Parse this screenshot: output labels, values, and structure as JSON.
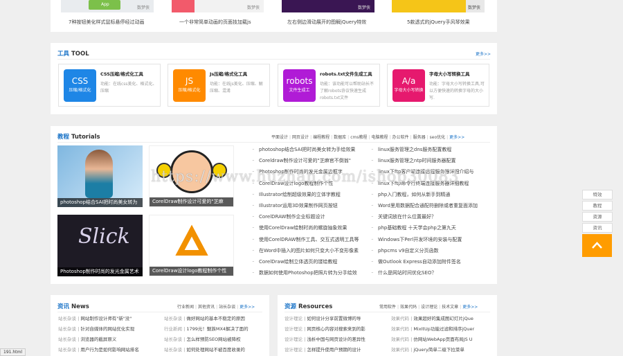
{
  "top_strip": {
    "items": [
      {
        "caption": "7种按钮美化样式鼠标悬停经过动画",
        "badge": "App",
        "watermark": "数梦侠"
      },
      {
        "caption": "一个非常简单动画的页面技加载js",
        "badge": "",
        "watermark": "数梦侠"
      },
      {
        "caption": "左右侧边滑动展开的图解jQuery特效",
        "badge": "",
        "watermark": "数梦侠"
      },
      {
        "caption": "5款透式的jQuery手风琴效果",
        "badge": "",
        "watermark": "数梦侠"
      }
    ]
  },
  "tools": {
    "title_hl": "工具",
    "title_rest": " TOOL",
    "more": "更多>>",
    "cards": [
      {
        "icon_big": "CSS",
        "icon_small": "压缩/格式化",
        "name": "CSS压缩/格式化工具",
        "desc": "功能：在线css美化、格式化、压缩",
        "color": "#1e86e6"
      },
      {
        "icon_big": "JS",
        "icon_small": "压缩/格式化",
        "name": "Js压缩/格式化工具",
        "desc": "功能：在线js美化、压缩、解压缩、混淆",
        "color": "#ff8a00"
      },
      {
        "icon_big": "robots",
        "icon_small": "文件生成工",
        "name": "robots.txt文件生成工具",
        "desc": "功能：该功能可以帮助站长不了解robots协议快速生成robots.txt文件",
        "color": "#b01bd6"
      },
      {
        "icon_big": "A/a",
        "icon_small": "字母大小写转换",
        "name": "字母大小写转换工具",
        "desc": "功能：字母大小写转换工具,可以方便快速的转换字母的大小写.",
        "color": "#e6196e"
      }
    ]
  },
  "tutorials": {
    "title_hl": "教程",
    "title_rest": " Tutorials",
    "nav": [
      "平面设计",
      "网页设计",
      "编程教程",
      "数据库",
      "cms教程",
      "电脑教程",
      "办公软件",
      "服务器",
      "seo优化"
    ],
    "more": "更多>>",
    "images": [
      "photoshop结合SAI把时尚美女转为",
      "CorelDraw制作设计可爱的\"芝麻",
      "Photoshop制作时尚的发光金属艺术",
      "CorelDraw设计logo教程制作个性"
    ],
    "list_left": [
      "photoshop结合SAI把时尚美女转为手绘效果",
      "Coreldraw制作设计可爱的\"芝麻官不倒翁\"",
      "Photoshop制作时尚的发光金属边框字",
      "CorelDraw设计logo教程制作个性",
      "Illustrator绘制超级效果的立体字教程",
      "Illustrator运用3D效果制作网页按钮",
      "CorelDRAW制作企业标题设计",
      "使用CorelDraw绘制时尚的螺旋抽象效果",
      "使用CorelDRAW制作工具、交互式透明工具等",
      "在Word中插入的图片如何只变大小不变形像素",
      "CorelDraw绘制立体透页的镂绘教程",
      "数据如何使用Photoshop把照片转为分手绘效"
    ],
    "list_right": [
      "linux服务管理之dns服务配置教程",
      "linux服务管理之ntp时间服务器配置",
      "linux下ftp客户端连接远程服务器详细介绍与",
      "linux下ftp命令行终端连接服务器详细教程",
      "php入门教程，如何从新手到精通",
      "Word里用数据配合通配符删除或者重复面添加",
      "关键词放在什么位置最好？",
      "php基础教程 十天学会php之第九天",
      "Windows下Perl开发环境的安装与配置",
      "phpcms v9自定义分页函数",
      "做Outlook Express自动添加附件签名",
      "什么是网站时间优化SEO？"
    ]
  },
  "news": {
    "title_hl": "资讯",
    "title_rest": " News",
    "nav": [
      "行业新闻",
      "其他资讯",
      "站长杂谈"
    ],
    "more": "更多>>",
    "left": [
      {
        "cat": "站长杂谈",
        "text": "网站制作设计师有\"新\"没\""
      },
      {
        "cat": "站长杂谈",
        "text": "针对自媒体的网站优化实现"
      },
      {
        "cat": "站长杂谈",
        "text": "浏览器的截屏原义"
      },
      {
        "cat": "站长杂谈",
        "text": "用户行为是如何影响网站排名"
      }
    ],
    "right": [
      {
        "cat": "站长杂谈",
        "text": "做好网站的基本不稳定的原因"
      },
      {
        "cat": "行业新闻",
        "text": "1799元！魅族MX4解决了面的"
      },
      {
        "cat": "站长杂谈",
        "text": "怎么样预防SEO网站被降权"
      },
      {
        "cat": "站长杂谈",
        "text": "如何处理网站不被百度收录的"
      }
    ]
  },
  "resources": {
    "title_hl": "资源",
    "title_rest": " Resources",
    "nav": [
      "常用软件",
      "效果代码",
      "设计理论",
      "技术文章"
    ],
    "more": "更多>>",
    "left": [
      {
        "cat": "设计理论",
        "text": "如何设计分享前置微博的导"
      },
      {
        "cat": "设计理论",
        "text": "网页核心内容对搜索来到的影"
      },
      {
        "cat": "设计理论",
        "text": "浅析中国与网页设计的差异性"
      },
      {
        "cat": "设计理论",
        "text": "怎样提升使用户预期的设计"
      }
    ],
    "right": [
      {
        "cat": "效果代码",
        "text": "效果超好的集成图幻灯片jQue"
      },
      {
        "cat": "效果代码",
        "text": "MixItUp功能过滤和排序jQuer"
      },
      {
        "cat": "效果代码",
        "text": "仿网站WebApp页面布局JS U"
      },
      {
        "cat": "效果代码",
        "text": "jQuery简单二级下拉菜单"
      }
    ]
  },
  "sidebar": {
    "buttons": [
      "特效",
      "教程",
      "资源",
      "资讯"
    ]
  },
  "watermark": "https://www.huzhan.com/ishop30083",
  "status_url": "191.html"
}
